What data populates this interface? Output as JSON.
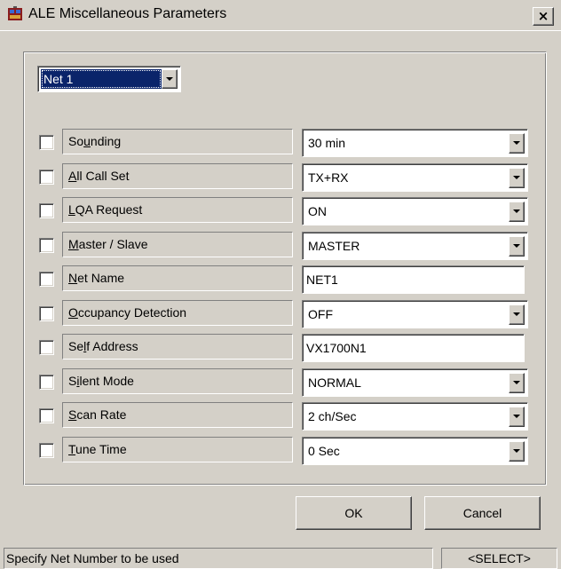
{
  "window": {
    "title": "ALE Miscellaneous Parameters",
    "close_label": "×"
  },
  "net_selector": {
    "value": "Net 1"
  },
  "params": [
    {
      "checked": false,
      "pre": "So",
      "key": "u",
      "post": "nding",
      "kind": "combo",
      "value": "30 min"
    },
    {
      "checked": false,
      "pre": "",
      "key": "A",
      "post": "ll Call Set",
      "kind": "combo",
      "value": "TX+RX"
    },
    {
      "checked": false,
      "pre": "",
      "key": "L",
      "post": "QA Request",
      "kind": "combo",
      "value": "ON"
    },
    {
      "checked": false,
      "pre": "",
      "key": "M",
      "post": "aster / Slave",
      "kind": "combo",
      "value": "MASTER"
    },
    {
      "checked": false,
      "pre": "",
      "key": "N",
      "post": "et Name",
      "kind": "text",
      "value": "NET1"
    },
    {
      "checked": false,
      "pre": "",
      "key": "O",
      "post": "ccupancy Detection",
      "kind": "combo",
      "value": "OFF"
    },
    {
      "checked": false,
      "pre": "Se",
      "key": "l",
      "post": "f Address",
      "kind": "text",
      "value": "VX1700N1"
    },
    {
      "checked": false,
      "pre": "S",
      "key": "i",
      "post": "lent Mode",
      "kind": "combo",
      "value": "NORMAL"
    },
    {
      "checked": false,
      "pre": "",
      "key": "S",
      "post": "can Rate",
      "kind": "combo",
      "value": "2 ch/Sec"
    },
    {
      "checked": false,
      "pre": "",
      "key": "T",
      "post": "une Time",
      "kind": "combo",
      "value": "0 Sec"
    }
  ],
  "buttons": {
    "ok": "OK",
    "cancel": "Cancel"
  },
  "status": {
    "message": "Specify Net Number to be used",
    "mode": "<SELECT>"
  }
}
